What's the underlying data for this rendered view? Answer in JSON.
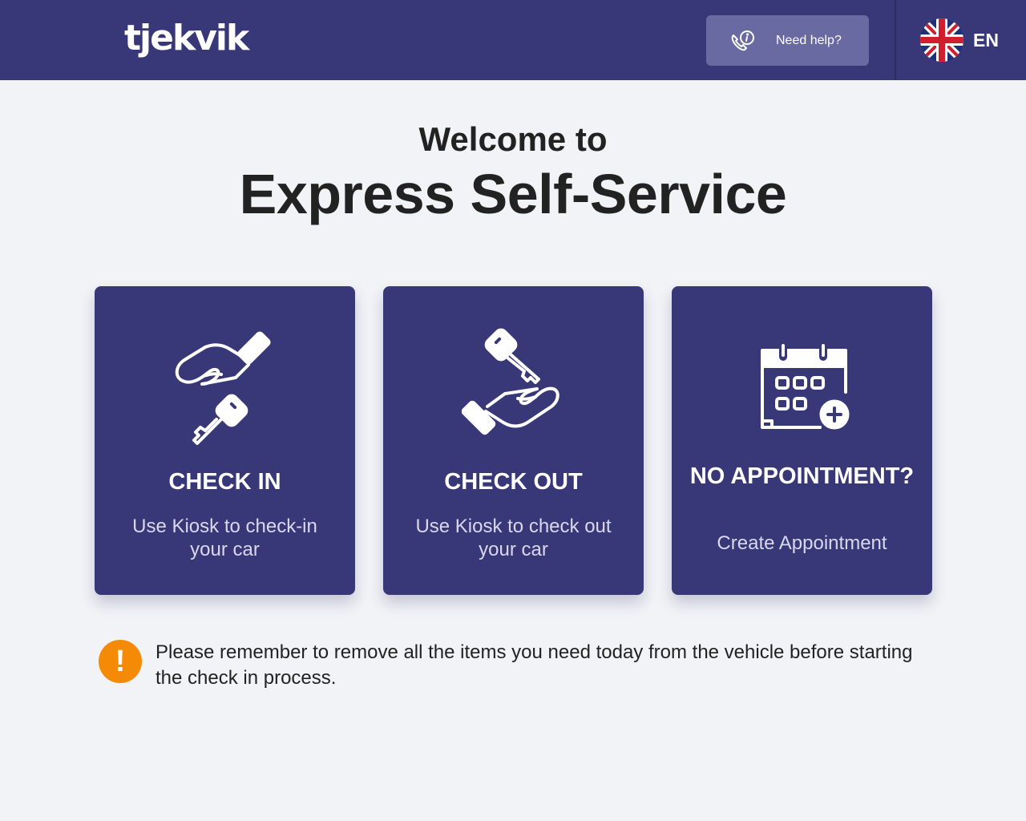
{
  "header": {
    "logo_text": "tjekvik",
    "help_label": "Need help?",
    "language_code": "EN"
  },
  "hero": {
    "welcome": "Welcome to",
    "title": "Express Self-Service"
  },
  "cards": [
    {
      "title": "CHECK IN",
      "subtitle": "Use Kiosk to check-in your car",
      "icon": "hand-key-icon"
    },
    {
      "title": "CHECK OUT",
      "subtitle": "Use Kiosk to check out your car",
      "icon": "key-hand-icon"
    },
    {
      "title": "NO APPOINTMENT?",
      "subtitle": "Create Appointment",
      "icon": "calendar-add-icon"
    }
  ],
  "notice": {
    "icon": "warning-icon",
    "symbol": "!",
    "text": "Please remember to remove all the items you need today from the vehicle before starting the check in process."
  },
  "colors": {
    "brand": "#383879",
    "background": "#f2f3f7",
    "help_button": "#6a6aa3",
    "warning": "#f58a07"
  }
}
